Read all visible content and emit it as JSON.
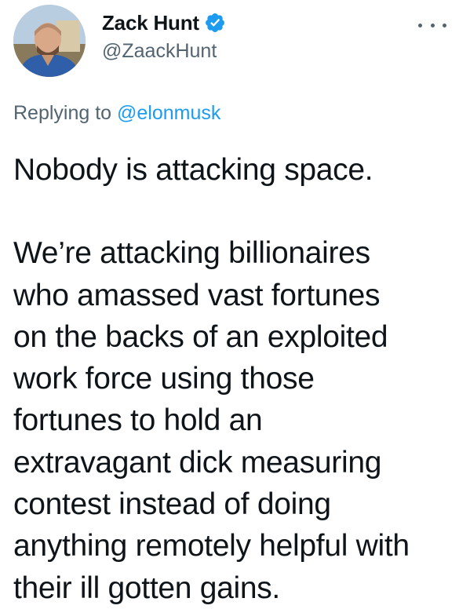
{
  "author": {
    "display_name": "Zack Hunt",
    "handle": "@ZaackHunt",
    "verified": true
  },
  "icons": {
    "verified": "verified-badge-icon",
    "more": "more-horizontal-icon"
  },
  "reply": {
    "prefix": "Replying to",
    "mention": "@elonmusk"
  },
  "tweet": {
    "line1": "Nobody is attacking space.",
    "paragraph2": "We’re attacking billionaires\nwho amassed vast fortunes\non the backs of an exploited\nwork force using those\nfortunes to hold an\nextravagant dick measuring\ncontest instead of doing\nanything remotely helpful with\ntheir ill gotten gains."
  },
  "colors": {
    "primary_text": "#0f1419",
    "secondary_text": "#536471",
    "accent": "#1d9bf0"
  }
}
